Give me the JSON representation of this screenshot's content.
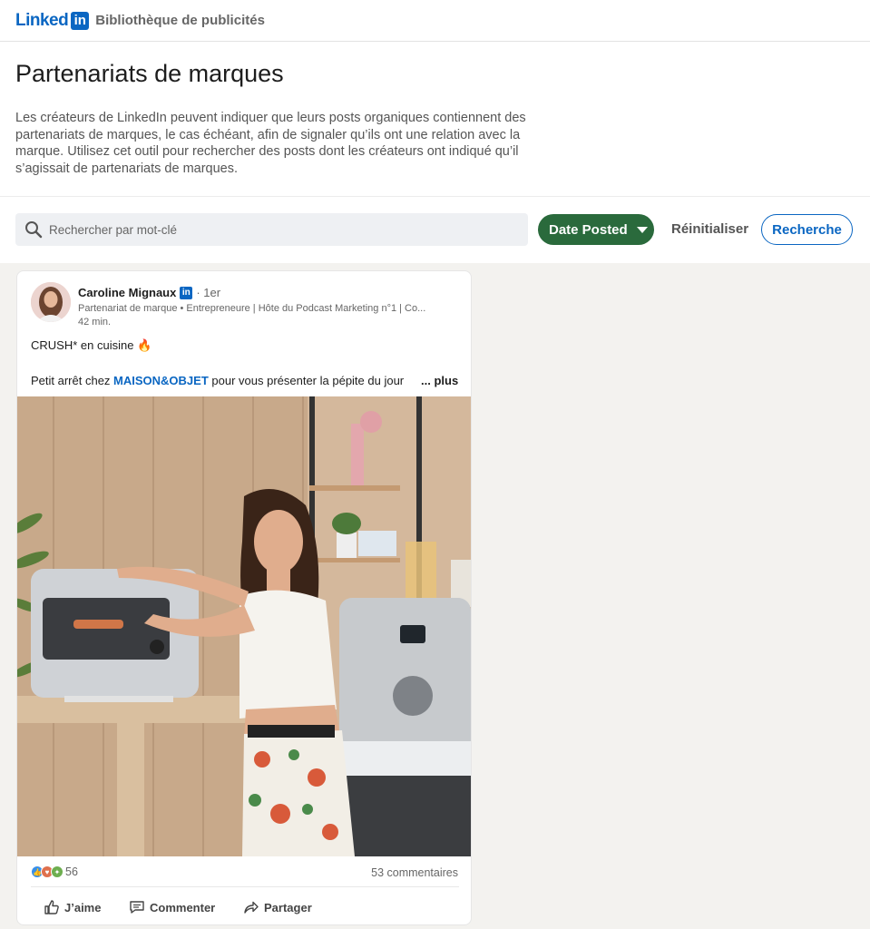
{
  "topbar": {
    "logo_text": "Linked",
    "logo_in": "in",
    "library_title": "Bibliothèque de publicités"
  },
  "header": {
    "title": "Partenariats de marques",
    "description": "Les créateurs de LinkedIn peuvent indiquer que leurs posts organiques contiennent des partenariats de marques, le cas échéant, afin de signaler qu’ils ont une relation avec la marque. Utilisez cet outil pour rechercher des posts dont les créateurs ont indiqué qu’il s’agissait de partenariats de marques."
  },
  "search": {
    "placeholder": "Rechercher par mot-clé",
    "date_button": "Date Posted",
    "reset_button": "Réinitialiser",
    "search_button": "Recherche"
  },
  "post": {
    "author_name": "Caroline Mignaux",
    "degree": "· 1er",
    "meta": "Partenariat de marque  •  Entrepreneure | Hôte du Podcast Marketing n°1 | Co...",
    "time": "42 min.",
    "line1": "CRUSH* en cuisine 🔥",
    "line2_prefix": "Petit arrêt chez ",
    "line2_mention": "MAISON&OBJET",
    "line2_suffix": " pour vous présenter la pépite du jour",
    "more": "... plus",
    "reactions_count": "56",
    "comments": "53 commentaires",
    "actions": {
      "like": "J’aime",
      "comment": "Commenter",
      "share": "Partager"
    }
  },
  "colors": {
    "brand": "#0a66c2",
    "date_button": "#2a6a3c",
    "feed_bg": "#f3f2ef"
  }
}
